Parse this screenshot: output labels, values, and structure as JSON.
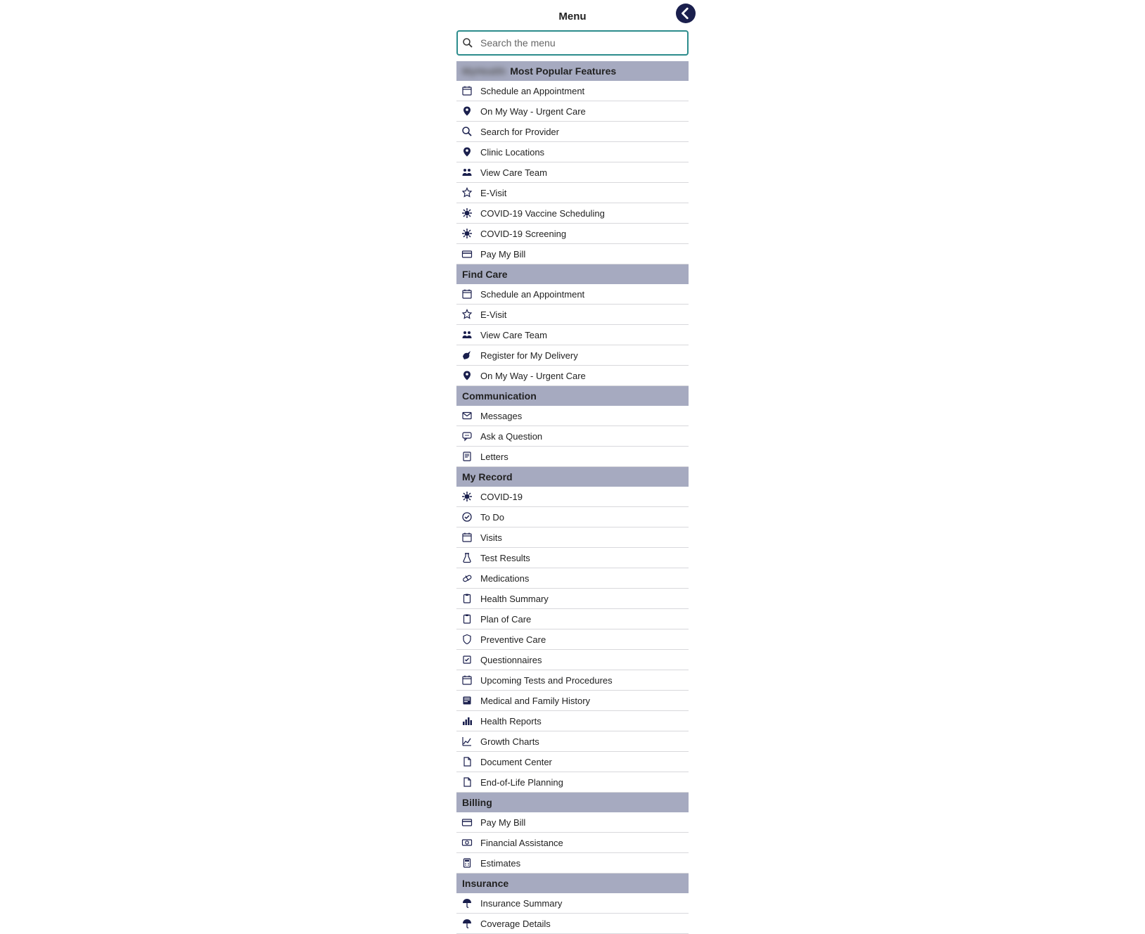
{
  "header": {
    "title": "Menu"
  },
  "search": {
    "placeholder": "Search the menu",
    "value": ""
  },
  "sections": [
    {
      "header": "Most Popular Features",
      "blurred_prefix": "MyHealth",
      "is_blurred": true,
      "items": [
        {
          "icon": "calendar-icon",
          "label": "Schedule an Appointment",
          "key": "schedule-appointment"
        },
        {
          "icon": "location-icon",
          "label": "On My Way - Urgent Care",
          "key": "on-my-way"
        },
        {
          "icon": "search-icon",
          "label": "Search for Provider",
          "key": "search-provider"
        },
        {
          "icon": "location-icon",
          "label": "Clinic Locations",
          "key": "clinic-locations"
        },
        {
          "icon": "team-icon",
          "label": "View Care Team",
          "key": "view-care-team"
        },
        {
          "icon": "star-icon",
          "label": "E-Visit",
          "key": "e-visit"
        },
        {
          "icon": "virus-icon",
          "label": "COVID-19 Vaccine Scheduling",
          "key": "covid-vaccine-scheduling"
        },
        {
          "icon": "virus-icon",
          "label": "COVID-19 Screening",
          "key": "covid-screening"
        },
        {
          "icon": "creditcard-icon",
          "label": "Pay My Bill",
          "key": "pay-my-bill"
        }
      ]
    },
    {
      "header": "Find Care",
      "items": [
        {
          "icon": "calendar-icon",
          "label": "Schedule an Appointment",
          "key": "schedule-appointment-2"
        },
        {
          "icon": "star-icon",
          "label": "E-Visit",
          "key": "e-visit-2"
        },
        {
          "icon": "team-icon",
          "label": "View Care Team",
          "key": "view-care-team-2"
        },
        {
          "icon": "stork-icon",
          "label": "Register for My Delivery",
          "key": "register-delivery"
        },
        {
          "icon": "location-icon",
          "label": "On My Way - Urgent Care",
          "key": "on-my-way-2"
        }
      ]
    },
    {
      "header": "Communication",
      "items": [
        {
          "icon": "envelope-icon",
          "label": "Messages",
          "key": "messages"
        },
        {
          "icon": "chat-icon",
          "label": "Ask a Question",
          "key": "ask-question"
        },
        {
          "icon": "letter-icon",
          "label": "Letters",
          "key": "letters"
        }
      ]
    },
    {
      "header": "My Record",
      "items": [
        {
          "icon": "virus-icon",
          "label": "COVID-19",
          "key": "covid19"
        },
        {
          "icon": "check-circle-icon",
          "label": "To Do",
          "key": "to-do"
        },
        {
          "icon": "calendar-icon",
          "label": "Visits",
          "key": "visits"
        },
        {
          "icon": "flask-icon",
          "label": "Test Results",
          "key": "test-results"
        },
        {
          "icon": "pill-icon",
          "label": "Medications",
          "key": "medications"
        },
        {
          "icon": "clipboard-icon",
          "label": "Health Summary",
          "key": "health-summary"
        },
        {
          "icon": "clipboard-icon",
          "label": "Plan of Care",
          "key": "plan-of-care"
        },
        {
          "icon": "shield-icon",
          "label": "Preventive Care",
          "key": "preventive-care"
        },
        {
          "icon": "checklist-icon",
          "label": "Questionnaires",
          "key": "questionnaires"
        },
        {
          "icon": "calendar-icon",
          "label": "Upcoming Tests and Procedures",
          "key": "upcoming-tests"
        },
        {
          "icon": "history-icon",
          "label": "Medical and Family History",
          "key": "medical-history"
        },
        {
          "icon": "chart-icon",
          "label": "Health Reports",
          "key": "health-reports"
        },
        {
          "icon": "growth-icon",
          "label": "Growth Charts",
          "key": "growth-charts"
        },
        {
          "icon": "document-icon",
          "label": "Document Center",
          "key": "document-center"
        },
        {
          "icon": "document-icon",
          "label": "End-of-Life Planning",
          "key": "end-of-life"
        }
      ]
    },
    {
      "header": "Billing",
      "items": [
        {
          "icon": "creditcard-icon",
          "label": "Pay My Bill",
          "key": "pay-my-bill-2"
        },
        {
          "icon": "money-icon",
          "label": "Financial Assistance",
          "key": "financial-assistance"
        },
        {
          "icon": "calculator-icon",
          "label": "Estimates",
          "key": "estimates"
        }
      ]
    },
    {
      "header": "Insurance",
      "items": [
        {
          "icon": "umbrella-icon",
          "label": "Insurance Summary",
          "key": "insurance-summary"
        },
        {
          "icon": "umbrella-icon",
          "label": "Coverage Details",
          "key": "coverage-details"
        }
      ]
    }
  ]
}
